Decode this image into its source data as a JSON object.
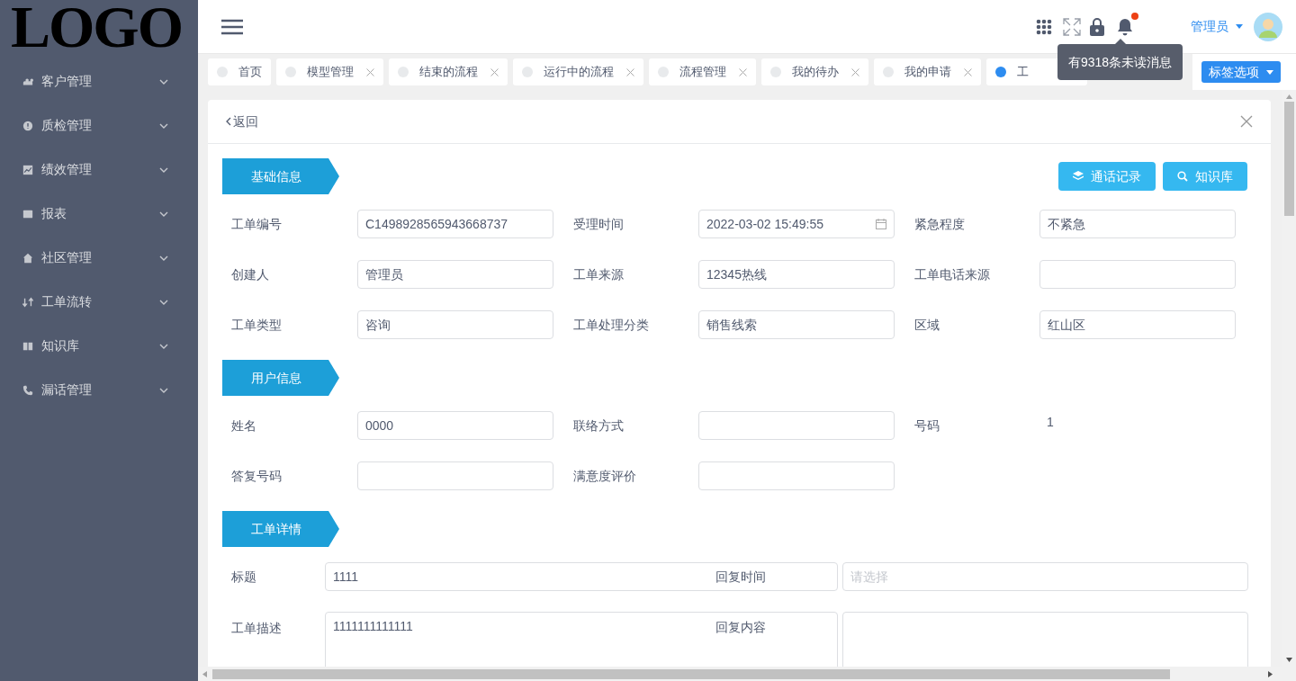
{
  "sidebar": {
    "logo": "LOGO",
    "items": [
      {
        "label": "客户管理"
      },
      {
        "label": "质检管理"
      },
      {
        "label": "绩效管理"
      },
      {
        "label": "报表"
      },
      {
        "label": "社区管理"
      },
      {
        "label": "工单流转"
      },
      {
        "label": "知识库"
      },
      {
        "label": "漏话管理"
      }
    ]
  },
  "header": {
    "user": "管理员",
    "notice": "有9318条未读消息"
  },
  "tabs": [
    {
      "label": "首页",
      "selected": false,
      "closable": false
    },
    {
      "label": "模型管理",
      "selected": false,
      "closable": true
    },
    {
      "label": "结束的流程",
      "selected": false,
      "closable": true
    },
    {
      "label": "运行中的流程",
      "selected": false,
      "closable": true
    },
    {
      "label": "流程管理",
      "selected": false,
      "closable": true
    },
    {
      "label": "我的待办",
      "selected": false,
      "closable": true
    },
    {
      "label": "我的申请",
      "selected": false,
      "closable": true
    },
    {
      "label": "工",
      "selected": true,
      "closable": false
    }
  ],
  "tab_options": "标签选项",
  "back": "返回",
  "sections": [
    {
      "title": "基础信息",
      "buttons": [
        "通话记录",
        "知识库"
      ],
      "fields": [
        {
          "label": "工单编号",
          "kind": "input",
          "value": "C1498928565943668737"
        },
        {
          "label": "受理时间",
          "kind": "date",
          "value": "2022-03-02 15:49:55"
        },
        {
          "label": "紧急程度",
          "kind": "input",
          "value": "不紧急"
        },
        {
          "label": "创建人",
          "kind": "input",
          "value": "管理员"
        },
        {
          "label": "工单来源",
          "kind": "input",
          "value": "12345热线"
        },
        {
          "label": "工单电话来源",
          "kind": "input"
        },
        {
          "label": "工单类型",
          "kind": "input",
          "value": "咨询"
        },
        {
          "label": "工单处理分类",
          "kind": "input",
          "value": "销售线索"
        },
        {
          "label": "区域",
          "kind": "input",
          "value": "红山区"
        }
      ]
    },
    {
      "title": "用户信息",
      "fields": [
        {
          "label": "姓名",
          "kind": "input",
          "value": "0000"
        },
        {
          "label": "联络方式",
          "kind": "input"
        },
        {
          "label": "号码",
          "kind": "text",
          "value": "1"
        },
        {
          "label": "答复号码",
          "kind": "input"
        },
        {
          "label": "满意度评价",
          "kind": "input"
        }
      ]
    },
    {
      "title": "工单详情",
      "rows": [
        {
          "label": "标题",
          "kind": "input",
          "value": "1111",
          "side_label": "回复时间",
          "side_placeholder": "请选择"
        },
        {
          "label": "工单描述",
          "kind": "textarea",
          "value": "1111111111111",
          "side_label": "回复内容"
        }
      ]
    }
  ]
}
